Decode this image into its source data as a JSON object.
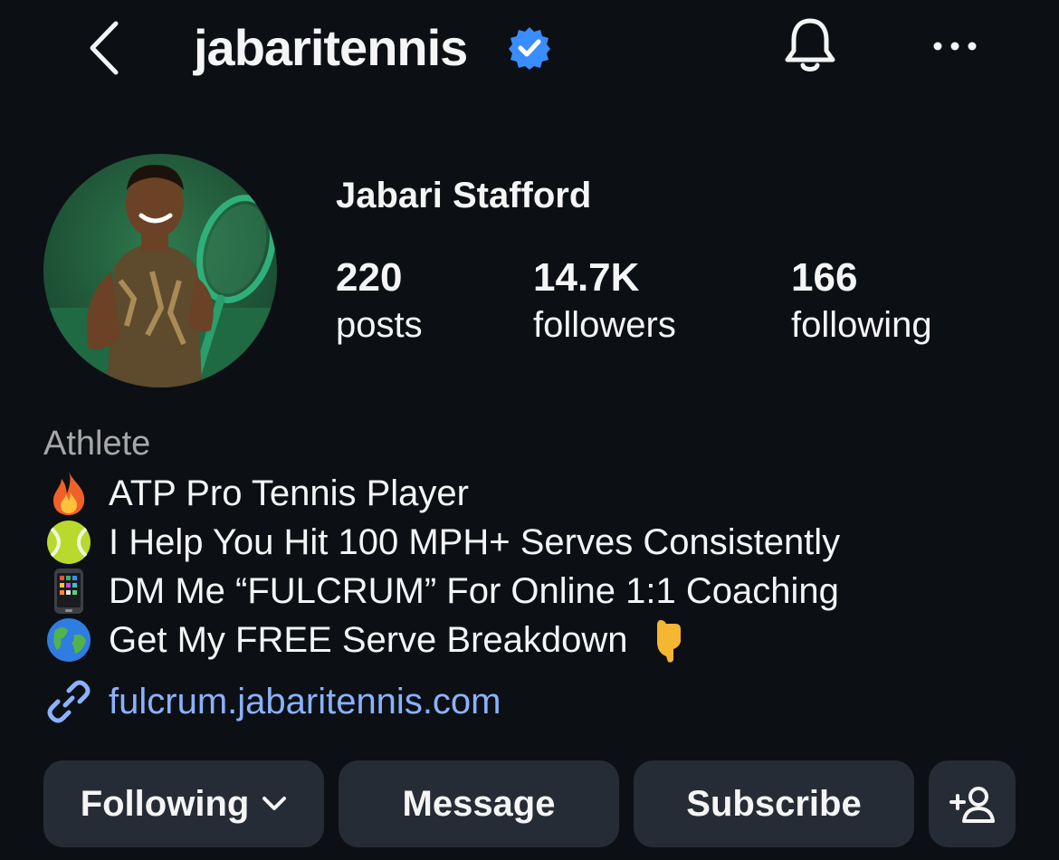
{
  "header": {
    "username": "jabaritennis",
    "verified": true,
    "icons": {
      "back": "chevron-left-icon",
      "verified": "verified-badge-icon",
      "notifications": "bell-icon",
      "more": "more-horizontal-icon"
    }
  },
  "profile": {
    "display_name": "Jabari Stafford",
    "avatar": "profile-photo",
    "stats": {
      "posts": {
        "value": "220",
        "label": "posts"
      },
      "followers": {
        "value": "14.7K",
        "label": "followers"
      },
      "following": {
        "value": "166",
        "label": "following"
      }
    }
  },
  "bio": {
    "category": "Athlete",
    "lines": [
      {
        "icon": "fire-emoji",
        "text": "ATP Pro Tennis Player"
      },
      {
        "icon": "tennis-ball-emoji",
        "text": "I Help You Hit 100 MPH+ Serves Consistently"
      },
      {
        "icon": "mobile-phone-emoji",
        "text": "DM Me “FULCRUM” For Online 1:1 Coaching"
      },
      {
        "icon": "globe-emoji",
        "text": "Get My FREE Serve Breakdown",
        "trailing_icon": "pointing-down-emoji"
      }
    ],
    "link": {
      "icon": "link-icon",
      "text": "fulcrum.jabaritennis.com"
    }
  },
  "actions": {
    "following_label": "Following",
    "message_label": "Message",
    "subscribe_label": "Subscribe",
    "add_person_icon": "add-person-icon"
  },
  "colors": {
    "background": "#0c1015",
    "button": "#262c36",
    "link": "#8bb2ff",
    "verified": "#3a8dff",
    "secondary_text": "#a8a8a8"
  }
}
